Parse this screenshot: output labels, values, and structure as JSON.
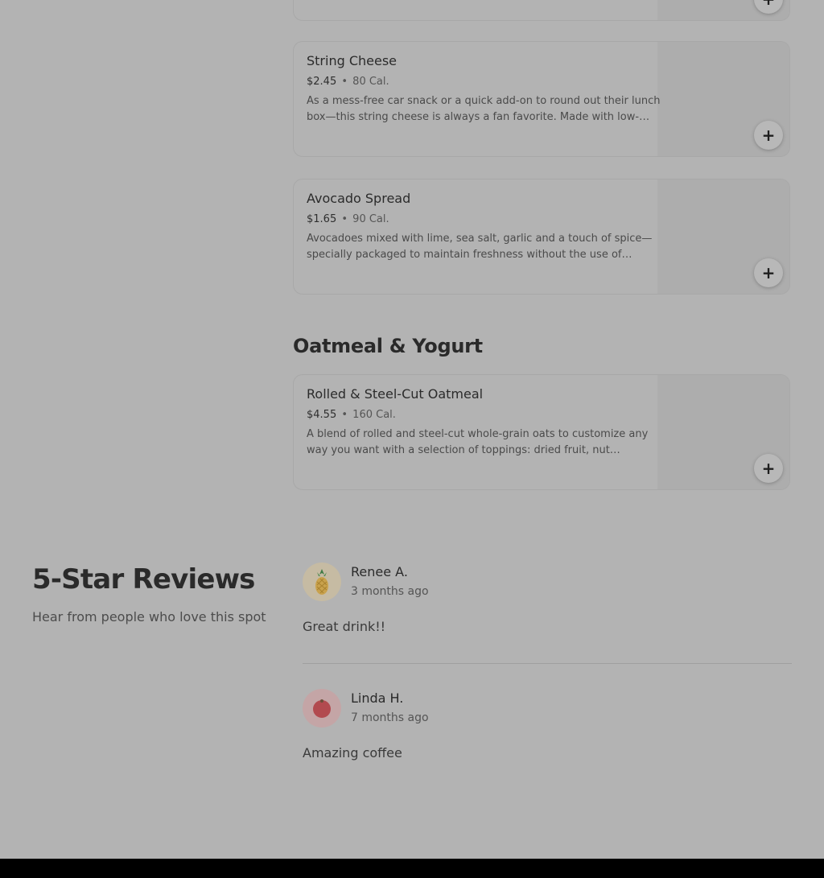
{
  "menu": {
    "items": [
      {
        "title": "String Cheese",
        "price": "$2.45",
        "separator": "•",
        "calories": "80 Cal.",
        "description": "As a mess-free car snack or a quick add-on to round out their lunch box—this string cheese is always a fan favorite. Made with low-…",
        "add_label": "+"
      },
      {
        "title": "Avocado Spread",
        "price": "$1.65",
        "separator": "•",
        "calories": "90 Cal.",
        "description": "Avocadoes mixed with lime, sea salt, garlic and a touch of spice—specially packaged to maintain freshness without the use of heat,…",
        "add_label": "+"
      }
    ],
    "partial_card": {
      "add_label": "+"
    },
    "section": {
      "title": "Oatmeal & Yogurt",
      "items": [
        {
          "title": "Rolled & Steel-Cut Oatmeal",
          "price": "$4.55",
          "separator": "•",
          "calories": "160 Cal.",
          "description": "A blend of rolled and steel-cut whole-grain oats to customize any way you want with a selection of toppings: dried fruit, nut medley,…",
          "add_label": "+"
        }
      ]
    }
  },
  "reviews": {
    "title": "5-Star Reviews",
    "subtitle": "Hear from people who love this spot",
    "items": [
      {
        "name": "Renee A.",
        "time": "3 months ago",
        "text": "Great drink!!",
        "avatar_icon": "pineapple-icon",
        "avatar_bg": "#c6bba3"
      },
      {
        "name": "Linda H.",
        "time": "7 months ago",
        "text": "Amazing coffee",
        "avatar_icon": "tomato-icon",
        "avatar_bg": "#c4a5a6"
      }
    ]
  },
  "colors": {
    "page_bg": "#b3b3b3",
    "footer_bg": "#000000"
  }
}
